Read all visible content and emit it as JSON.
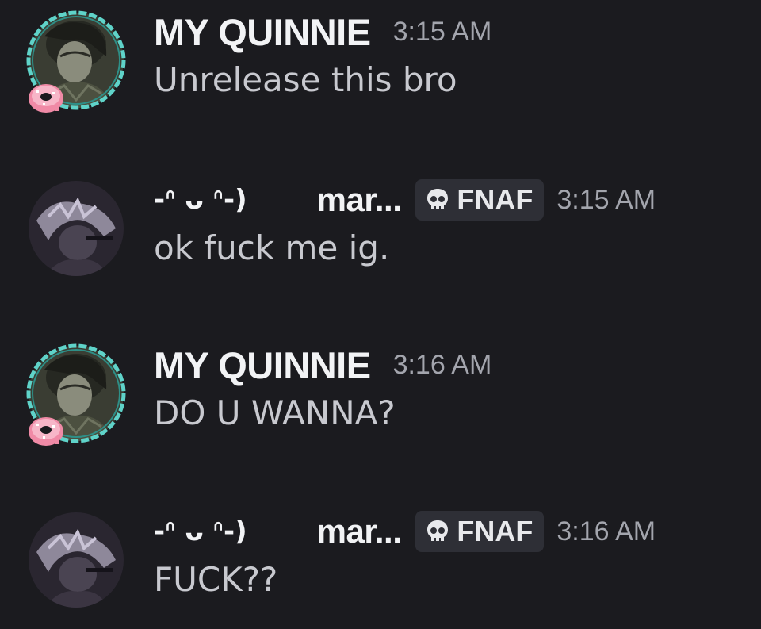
{
  "messages": [
    {
      "username": "MY QUINNIE",
      "timestamp": "3:15 AM",
      "content": "Unrelease this bro"
    },
    {
      "display_name": "-ᐢ ᴗ ᐢ-)",
      "username": "mar...",
      "tag": "FNAF",
      "tag_icon": "skull-icon",
      "timestamp": "3:15 AM",
      "content": "ok fuck me ig."
    },
    {
      "username": "MY QUINNIE",
      "timestamp": "3:16 AM",
      "content": "DO U WANNA?"
    },
    {
      "display_name": "-ᐢ ᴗ ᐢ-)",
      "username": "mar...",
      "tag": "FNAF",
      "tag_icon": "skull-icon",
      "timestamp": "3:16 AM",
      "content": "FUCK??"
    }
  ],
  "colors": {
    "background": "#1b1b1f",
    "username": "#f2f3f5",
    "message_text": "#c8c9cf",
    "timestamp": "#a3a5ad",
    "tag_background": "#2e2f36",
    "avatar_frame": "#5fd3c9",
    "donut": "#f08aa6"
  }
}
